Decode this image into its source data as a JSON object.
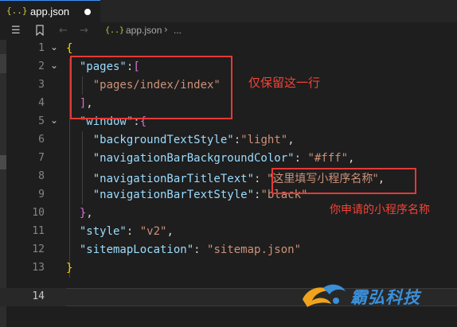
{
  "tab": {
    "icon": "{..}",
    "title": "app.json",
    "unsaved": true
  },
  "breadcrumb": {
    "icon": "{..}",
    "file": "app.json",
    "separator": "›",
    "more": "..."
  },
  "line_numbers": [
    "1",
    "2",
    "3",
    "4",
    "5",
    "6",
    "7",
    "8",
    "9",
    "10",
    "11",
    "12",
    "13",
    "14"
  ],
  "active_line": "14",
  "code": {
    "l1_open": "{",
    "l2_key": "\"pages\"",
    "l2_colon": ":",
    "l2_bracket": "[",
    "l3_value": "\"pages/index/index\"",
    "l4_bracket": "]",
    "l4_comma": ",",
    "l5_key": "\"window\"",
    "l5_colon": ":",
    "l5_brace": "{",
    "l6_key": "\"backgroundTextStyle\"",
    "l6_colon": ":",
    "l6_value": "\"light\"",
    "l6_comma": ",",
    "l7_key": "\"navigationBarBackgroundColor\"",
    "l7_colon": ": ",
    "l7_value": "\"#fff\"",
    "l7_comma": ",",
    "l8_key": "\"navigationBarTitleText\"",
    "l8_colon": ": ",
    "l8_value": "\"这里填写小程序名称\"",
    "l8_comma": ",",
    "l9_key": "\"navigationBarTextStyle\"",
    "l9_colon": ":",
    "l9_value": "\"black\"",
    "l10_brace": "}",
    "l10_comma": ",",
    "l11_key": "\"style\"",
    "l11_colon": ": ",
    "l11_value": "\"v2\"",
    "l11_comma": ",",
    "l12_key": "\"sitemapLocation\"",
    "l12_colon": ": ",
    "l12_value": "\"sitemap.json\"",
    "l13_close": "}"
  },
  "annotations": {
    "keep_line": "仅保留这一行",
    "app_name": "你申请的小程序名称"
  },
  "watermark": {
    "text": "霸弘科技"
  },
  "colors": {
    "annotation_red": "#e53935",
    "key_blue": "#9cdcfe",
    "string_orange": "#ce9178",
    "bracket_gold": "#ffd700",
    "bracket_purple": "#da70d6",
    "bracket_blue": "#179fff"
  }
}
